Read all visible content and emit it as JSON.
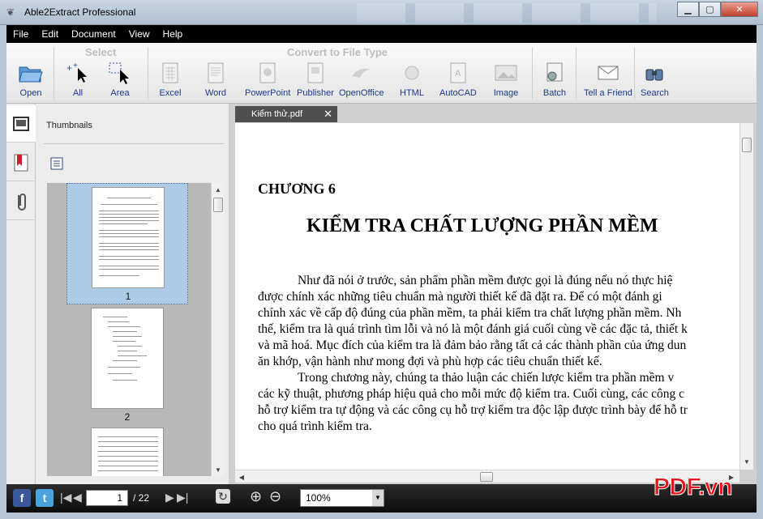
{
  "window": {
    "title": "Able2Extract Professional"
  },
  "menu": [
    "File",
    "Edit",
    "Document",
    "View",
    "Help"
  ],
  "toolbar": {
    "select_group": "Select",
    "convert_group": "Convert to File Type",
    "buttons": {
      "open": "Open",
      "all": "All",
      "area": "Area",
      "excel": "Excel",
      "word": "Word",
      "powerpoint": "PowerPoint",
      "publisher": "Publisher",
      "openoffice": "OpenOffice",
      "html": "HTML",
      "autocad": "AutoCAD",
      "image": "Image",
      "batch": "Batch",
      "tell_friend": "Tell a Friend",
      "search": "Search"
    }
  },
  "panel": {
    "title": "Thumbnails",
    "thumb_numbers": [
      "1",
      "2"
    ]
  },
  "tab": {
    "label": "Kiểm thử.pdf"
  },
  "document": {
    "chapter": "CHƯƠNG 6",
    "heading": "KIỂM TRA CHẤT LƯỢNG PHẦN MỀM",
    "lines": [
      "Như đã nói ở trước, sản phẩm phần mềm được gọi là đúng nếu nó thực hiệ",
      "được chính xác những tiêu chuẩn mà người thiết kế đã đặt ra. Để có một đánh gi",
      "chính xác về cấp độ đúng của phần mềm, ta phải kiểm tra chất lượng phần mềm. Nh",
      "thế, kiểm tra là quá trình tìm lỗi và nó là một đánh giá cuối cùng về các đặc tả, thiết k",
      "và mã hoá. Mục đích của kiểm tra là đảm bảo rằng tất cả các thành phần của ứng dun",
      "ăn khớp, vận hành như mong đợi và phù hợp các tiêu chuẩn thiết kế.",
      "Trong chương này, chúng ta thảo luận các chiến lược kiểm tra phần mềm v",
      "các kỹ thuật, phương pháp hiệu quả cho mỗi mức độ kiểm tra. Cuối cùng, các công c",
      "hỗ trợ kiểm tra tự động và các công cụ hỗ trợ kiểm tra độc lập được trình bày để hỗ tr",
      "cho quá trình kiểm tra."
    ]
  },
  "statusbar": {
    "page_current": "1",
    "page_total": "/ 22",
    "zoom": "100%"
  },
  "watermark": "PDF.vn",
  "colors": {
    "menubar": "#000000",
    "link_blue": "#1a3a8a",
    "watermark": "#e8141b",
    "thumb_selected": "#aecbe6"
  }
}
